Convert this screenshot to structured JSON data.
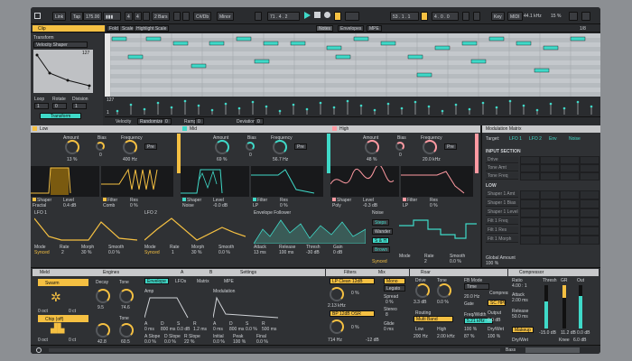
{
  "transport": {
    "link": "Link",
    "tap": "Tap",
    "bpm": "175.00",
    "sig_num": "4",
    "sig_den": "4",
    "quant": "2 Bars",
    "key": "C#/Db",
    "scale": "Minor",
    "pos": "71 . 4 . 2",
    "loop_pos": "53 . 1 . 1",
    "loop_len": "4 . 0 . 0",
    "key_btn": "Key",
    "midi": "MIDI",
    "sample_rate": "44.1 kHz",
    "cpu": "15 %"
  },
  "clip": {
    "title": "Clip",
    "fold": "Fold",
    "scale": "Scale",
    "highlight": "Highlight Scale",
    "tab_notes": "Notes",
    "tab_envelopes": "Envelopes",
    "tab_mpe": "MPE",
    "transform": "Transform",
    "shaper": "Velocity Shaper",
    "val_top": "127",
    "val_bottom": "1",
    "loop_label": "Loop",
    "rotate_label": "Rotate",
    "division_label": "Division",
    "loop_val": "1",
    "rotate_val": "0",
    "division_val": "1",
    "transform_btn": "Transform",
    "velocity": "Velocity",
    "randomize": "Randomize",
    "ramp": "Ramp",
    "deviation": "Deviation",
    "vel_val": "0",
    "ramp_val": "0",
    "dev_val": "0",
    "grid_fraction": "1/8",
    "vel_max": "127",
    "vel_min": "1"
  },
  "bands": [
    {
      "name": "Low",
      "amount_label": "Amount",
      "amount": "13 %",
      "bias_label": "Bias",
      "bias": "0",
      "freq_label": "Frequency",
      "freq": "400 Hz",
      "pre": "Pre",
      "shaper_label": "Shaper",
      "level_label": "Level",
      "shaper": "Fractal",
      "level": "0.4 dB",
      "filter_label": "Filter",
      "res_label": "Res",
      "filter": "Comb",
      "res": "0 %"
    },
    {
      "name": "Mid",
      "amount_label": "Amount",
      "amount": "69 %",
      "bias_label": "Bias",
      "bias": "0",
      "freq_label": "Frequency",
      "freq": "56.7 Hz",
      "pre": "Pre",
      "shaper_label": "Shaper",
      "level_label": "Level",
      "shaper": "Noise",
      "level": "-0.0 dB",
      "filter_label": "Filter",
      "res_label": "Res",
      "filter": "LP",
      "res": "0 %"
    },
    {
      "name": "High",
      "amount_label": "Amount",
      "amount": "48 %",
      "bias_label": "Bias",
      "bias": "0",
      "freq_label": "Frequency",
      "freq": "20.0 kHz",
      "pre": "Pre",
      "shaper_label": "Shaper",
      "level_label": "Level",
      "shaper": "Poly",
      "level": "-0.3 dB",
      "filter_label": "Filter",
      "res_label": "Res",
      "filter": "LP",
      "res": "0 %"
    }
  ],
  "lfo1": {
    "name": "LFO 1",
    "mode_label": "Mode",
    "rate_label": "Rate",
    "morph_label": "Morph",
    "smooth_label": "Smooth",
    "mode": "Synced",
    "rate": "2",
    "morph": "30 %",
    "smooth": "0.0 %"
  },
  "lfo2": {
    "name": "LFO 2",
    "mode_label": "Mode",
    "rate_label": "Rate",
    "morph_label": "Morph",
    "smooth_label": "Smooth",
    "mode": "Synced",
    "rate": "1",
    "morph": "30 %",
    "smooth": "0.0 %"
  },
  "env": {
    "name": "Envelope Follower",
    "attack_label": "Attack",
    "release_label": "Release",
    "thresh_label": "Thresh",
    "gain_label": "Gain",
    "attack": "13 ms",
    "release": "100 ms",
    "thresh": "-30 dB",
    "gain": "0 dB"
  },
  "noise": {
    "name": "Noise",
    "steps": "Steps",
    "wander": "Wander",
    "sh": "S & H",
    "brown": "Brown",
    "mode_label": "Mode",
    "rate_label": "Rate",
    "smooth_label": "Smooth",
    "mode": "Synced",
    "rate": "2",
    "smooth": "0.0 %"
  },
  "modmatrix": {
    "title": "Modulation Matrix",
    "target": "Target:",
    "tabs": [
      "LFO 1",
      "LFO 2",
      "Env",
      "Noise"
    ],
    "input_section": "INPUT SECTION",
    "input_rows": [
      "Drive",
      "Tone Amt",
      "Tone Freq"
    ],
    "low": "LOW",
    "low_rows": [
      "Shaper 1 Amt",
      "Shaper 1 Bias",
      "Shaper 1 Level",
      "Filt 1 Freq",
      "Filt 1 Res",
      "Filt 1 Morph"
    ],
    "global_label": "Global Amount",
    "global": "100 %"
  },
  "meld": {
    "title": "Meld",
    "engines": "Engines",
    "tab_a": "A",
    "tab_b": "B",
    "settings": "Settings",
    "oct1": "0 ct",
    "oct2": "0 ct",
    "oct_label": "0 oct",
    "osc_a": "Swarm",
    "osc_b": "Chip (off)",
    "decay_label": "Decay",
    "tone_label": "Tone",
    "decay": "9.5",
    "tone": "74.6",
    "tone2_label": "Tone",
    "tone2": "42.8",
    "tone3": "60.5",
    "env_label": "Envelope",
    "env1_label": "Amp",
    "modulation": "Modulation",
    "lfo_tab": "LFOs",
    "matrix_tab": "Matrix",
    "mpe_tab": "MPE",
    "a_label": "A",
    "d_label": "D",
    "s_label": "S",
    "r_label": "R",
    "a": "0 ms",
    "d": "800 ms",
    "s": "0.0 dB",
    "r": "1.2 ms",
    "mod_a": "0 ms",
    "mod_d": "800 ms",
    "mod_s": "0.0 %",
    "mod_r": "500 ms",
    "aslope_label": "A Slope",
    "dslope_label": "D Slope",
    "rslope_label": "R Slope",
    "aslope": "0.0 %",
    "dslope": "0.0 %",
    "rslope": "22 %",
    "initial_label": "Initial",
    "peak_label": "Peak",
    "final_label": "Final",
    "initial": "0.0 %",
    "peak": "100 %",
    "final": "0.0 %"
  },
  "filters": {
    "title": "Filters",
    "mix": "Mix",
    "filter1": "LP Clean 12dB",
    "filter2": "BP 12dB OSR",
    "freq1": "2.13 kHz",
    "freq2": "714 Hz",
    "res1": "0 %",
    "res2": "0 %",
    "drive": "Drive",
    "mono": "Mono",
    "legato": "Legato",
    "spread": "Spread",
    "spread_val": "0 %",
    "stereo": "Stereo",
    "voices": "8",
    "vol_label": "Volume",
    "vol": "-12 dB",
    "glide": "Glide",
    "glide_val": "0 ms"
  },
  "roar": {
    "title": "Roar",
    "drive_label": "Drive",
    "tone_label": "Tone",
    "drive": "3.3 dB",
    "tone": "0.0 %",
    "color_label": "Color",
    "color": "0.0 %",
    "routing_label": "Routing",
    "routing": "Multi Band",
    "low_label": "Low",
    "high_label": "High",
    "low": "200 Hz",
    "high": "2.00 kHz",
    "fb_mode": "FB Mode",
    "fb_val": "Time",
    "freq": "20.0 Hz",
    "gate": "Gate",
    "freq_width": "Freq/Width",
    "fw1": "5.21 kHz",
    "fw2": "100 %",
    "amount": "87 %",
    "output": "0.0 dB",
    "dry_wet": "Dry/Wet",
    "dw_val": "100 %",
    "comp": "Compression",
    "sc_hpf": "SC HPF",
    "out_label": "Output"
  },
  "compressor": {
    "title": "Compressor",
    "ratio_label": "Ratio",
    "ratio": "4.00 : 1",
    "attack_label": "Attack",
    "attack": "2.00 ms",
    "release_label": "Release",
    "release": "50.0 ms",
    "thresh_label": "Thresh",
    "gr_label": "GR",
    "out_label": "Out",
    "thresh": "-15.0 dB",
    "gr": "11.2 dB",
    "out": "0.0 dB",
    "knee_label": "Knee",
    "knee": "6.0 dB",
    "drywet_label": "Dry/Wet",
    "drywet": "100 %",
    "makeup": "Makeup"
  },
  "bottom": {
    "bass": "Bass"
  }
}
